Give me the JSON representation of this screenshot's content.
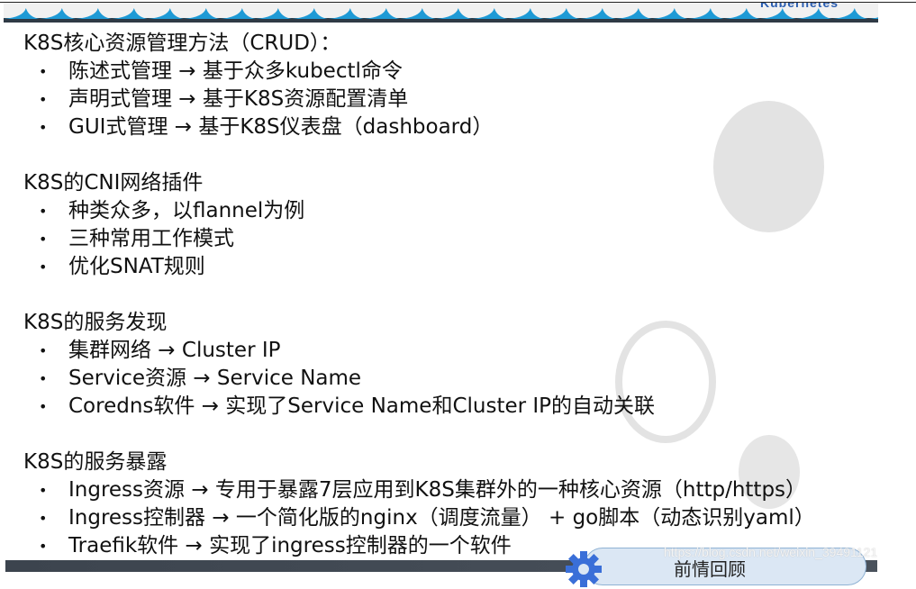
{
  "header": {
    "brand_label": "Kubernetes"
  },
  "sections": [
    {
      "title": "K8S核心资源管理方法（CRUD）：",
      "items": [
        "陈述式管理 → 基于众多kubectl命令",
        "声明式管理 → 基于K8S资源配置清单",
        "GUI式管理 → 基于K8S仪表盘（dashboard）"
      ]
    },
    {
      "title": "K8S的CNI网络插件",
      "items": [
        "种类众多，以flannel为例",
        "三种常用工作模式",
        "优化SNAT规则"
      ]
    },
    {
      "title": "K8S的服务发现",
      "items": [
        "集群网络 → Cluster IP",
        "Service资源 → Service Name",
        "Coredns软件 → 实现了Service Name和Cluster IP的自动关联"
      ]
    },
    {
      "title": "K8S的服务暴露",
      "items": [
        "Ingress资源 → 专用于暴露7层应用到K8S集群外的一种核心资源（http/https）",
        "Ingress控制器 → 一个简化版的nginx（调度流量） + go脚本（动态识别yaml）",
        "Traefik软件 → 实现了ingress控制器的一个软件"
      ]
    }
  ],
  "bullet_glyph": "•",
  "footer": {
    "review_label": "前情回顾",
    "watermark": "https://blog.csdn.net/weixin_39491121"
  },
  "colors": {
    "wave_blue": "#1e9ad6",
    "wave_dark": "#2f3a45",
    "gear_blue": "#3a6fd8",
    "pill_bg": "#dbe7f4"
  }
}
